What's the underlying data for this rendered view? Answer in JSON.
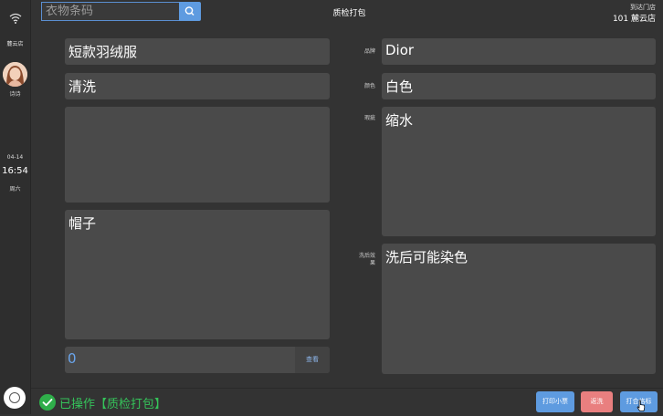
{
  "sidebar": {
    "store_name": "麓云店",
    "user_name": "诗诗",
    "date": "04-14",
    "time": "16:54",
    "weekday": "周六",
    "icons": {
      "wifi": "wifi-icon",
      "home": "home-button"
    }
  },
  "header": {
    "search_placeholder": "衣物条码",
    "search_value": "",
    "title": "质检打包",
    "destination_label": "到达门店",
    "destination_store": "101 麓云店"
  },
  "left": {
    "garment_name": "短款羽绒服",
    "service": "清洗",
    "notes": "",
    "accessory": "帽子",
    "count_value": "0",
    "view_label": "查看"
  },
  "right": {
    "brand_label": "品牌",
    "brand_value": "Dior",
    "color_label": "颜色",
    "color_value": "白色",
    "defect_label": "瑕疵",
    "defect_value": "缩水",
    "effect_label": "洗后效果",
    "effect_value": "洗后可能染色"
  },
  "footer": {
    "status_text": "已操作【质检打包】",
    "btn_print_receipt": "打印小票",
    "btn_rewash": "返洗",
    "btn_print_tag": "打合格标"
  },
  "colors": {
    "background": "#333333",
    "field": "#4a4a4a",
    "accent_blue": "#5e9be0",
    "accent_red": "#e97f7f",
    "success_green": "#35c35a"
  }
}
